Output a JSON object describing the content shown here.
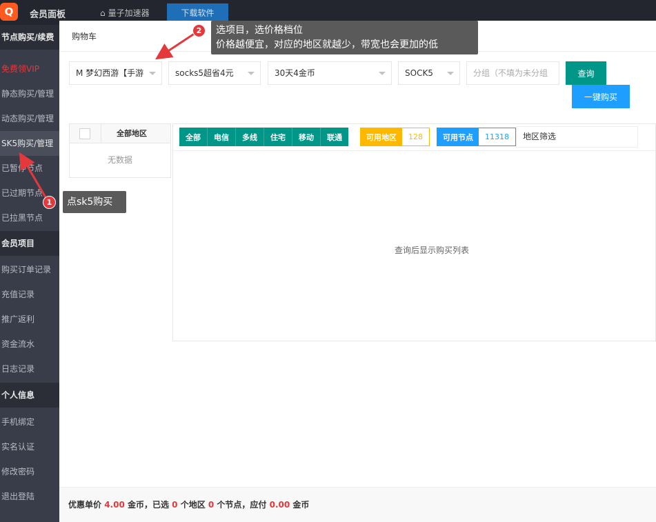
{
  "topbar": {
    "logo_icon": "Q",
    "title": "会员面板",
    "home_label": "量子加速器",
    "download_label": "下载软件"
  },
  "sidebar": {
    "items": [
      {
        "label": "节点购买/续费",
        "kind": "header"
      },
      {
        "label": "免费领VIP",
        "kind": "vip"
      },
      {
        "label": "静态购买/管理",
        "kind": "item"
      },
      {
        "label": "动态购买/管理",
        "kind": "item"
      },
      {
        "label": "SK5购买/管理",
        "kind": "active"
      },
      {
        "label": "已暂停节点",
        "kind": "item"
      },
      {
        "label": "已过期节点",
        "kind": "item"
      },
      {
        "label": "已拉黑节点",
        "kind": "item"
      },
      {
        "label": "会员项目",
        "kind": "header"
      },
      {
        "label": "购买订单记录",
        "kind": "item"
      },
      {
        "label": "充值记录",
        "kind": "item"
      },
      {
        "label": "推广返利",
        "kind": "item"
      },
      {
        "label": "资金流水",
        "kind": "item"
      },
      {
        "label": "日志记录",
        "kind": "item"
      },
      {
        "label": "个人信息",
        "kind": "header"
      },
      {
        "label": "手机绑定",
        "kind": "item"
      },
      {
        "label": "实名认证",
        "kind": "item"
      },
      {
        "label": "修改密码",
        "kind": "item"
      },
      {
        "label": "退出登陆",
        "kind": "item"
      }
    ]
  },
  "modal": {
    "title": "购物车",
    "selects": {
      "project": "M 梦幻西游【手游",
      "package": "socks5超省4元",
      "duration": "30天4金币",
      "protocol": "SOCK5"
    },
    "group_placeholder": "分组（不填为未分组",
    "query_label": "查询",
    "buy_label": "一键购买",
    "region_table": {
      "header": "全部地区",
      "empty": "无数据"
    },
    "isp_buttons": [
      "全部",
      "电信",
      "多线",
      "住宅",
      "移动",
      "联通"
    ],
    "available_regions": {
      "label": "可用地区",
      "count": "128"
    },
    "available_nodes": {
      "label": "可用节点",
      "count": "11318"
    },
    "region_filter": "地区筛选",
    "panel_empty": "查询后显示购买列表",
    "footer": {
      "t1": "优惠单价 ",
      "price": "4.00",
      "t2": " 金币，已选 ",
      "regions": "0",
      "t3": " 个地区 ",
      "nodes": "0",
      "t4": " 个节点，应付 ",
      "total": "0.00",
      "t5": " 金币"
    }
  },
  "annotations": {
    "step1": {
      "badge": "1",
      "text": "点sk5购买"
    },
    "step2": {
      "badge": "2",
      "line1": "选项目，选价格档位",
      "line2": "价格越便宜，对应的地区就越少，带宽也会更加的低"
    }
  },
  "colors": {
    "teal": "#009688",
    "blue": "#1e9fff",
    "orange": "#ffb800",
    "red": "#e4393c",
    "sidebar": "#393d49"
  }
}
